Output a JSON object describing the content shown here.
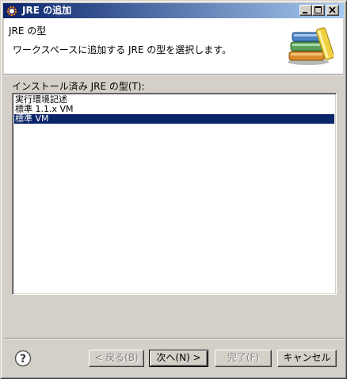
{
  "window": {
    "title": "JRE の追加",
    "icon": "eclipse-icon",
    "controls": [
      "minimize-icon",
      "maximize-icon",
      "close-icon"
    ]
  },
  "header": {
    "title": "JRE の型",
    "description": "ワークスペースに追加する JRE の型を選択します。",
    "graphic": "library-books-icon"
  },
  "jre_types": {
    "label": "インストール済み JRE の型(T):",
    "items": [
      {
        "label": "実行環境記述",
        "selected": false
      },
      {
        "label": "標準 1.1.x VM",
        "selected": false
      },
      {
        "label": "標準 VM",
        "selected": true
      }
    ]
  },
  "footer": {
    "help_icon": "help-icon",
    "back_label": "< 戻る(B)",
    "next_label": "次へ(N) >",
    "finish_label": "完了(F)",
    "cancel_label": "キャンセル"
  },
  "colors": {
    "selection": "#0a246a",
    "titlebar_start": "#0a246a",
    "titlebar_end": "#a6caf0",
    "face": "#d4d0c8"
  }
}
